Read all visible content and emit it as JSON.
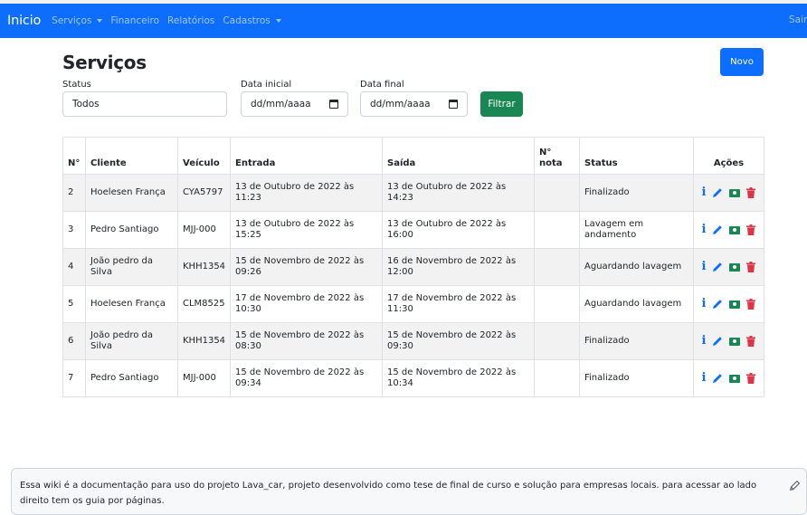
{
  "navbar": {
    "brand": "Inicio",
    "items": [
      {
        "label": "Serviços",
        "dropdown": true
      },
      {
        "label": "Financeiro",
        "dropdown": false
      },
      {
        "label": "Relatórios",
        "dropdown": false
      },
      {
        "label": "Cadastros",
        "dropdown": true
      }
    ],
    "logout": "Sair",
    "color": "#0d6efd"
  },
  "page": {
    "title": "Serviços",
    "new_button": "Novo"
  },
  "filters": {
    "status_label": "Status",
    "status_value": "Todos",
    "start_label": "Data inicial",
    "start_value": "dd/mm/aaaa",
    "end_label": "Data final",
    "end_value": "dd/mm/aaaa",
    "filter_button": "Filtrar"
  },
  "table": {
    "headers": {
      "num": "N°",
      "cliente": "Cliente",
      "veiculo": "Veículo",
      "entrada": "Entrada",
      "saida": "Saída",
      "nota": "N° nota",
      "status": "Status",
      "acoes": "Ações"
    },
    "rows": [
      {
        "num": "2",
        "cliente": "Hoelesen França",
        "veiculo": "CYA5797",
        "entrada": "13 de Outubro de 2022 às 11:23",
        "saida": "13 de Outubro de 2022 às 14:23",
        "nota": "",
        "status": "Finalizado"
      },
      {
        "num": "3",
        "cliente": "Pedro Santiago",
        "veiculo": "MJJ-000",
        "entrada": "13 de Outubro de 2022 às 15:25",
        "saida": "13 de Outubro de 2022 às 16:00",
        "nota": "",
        "status": "Lavagem em andamento"
      },
      {
        "num": "4",
        "cliente": "João pedro da Silva",
        "veiculo": "KHH1354",
        "entrada": "15 de Novembro de 2022 às 09:26",
        "saida": "16 de Novembro de 2022 às 12:00",
        "nota": "",
        "status": "Aguardando lavagem"
      },
      {
        "num": "5",
        "cliente": "Hoelesen França",
        "veiculo": "CLM8525",
        "entrada": "17 de Novembro de 2022 às 10:30",
        "saida": "17 de Novembro de 2022 às 11:30",
        "nota": "",
        "status": "Aguardando lavagem"
      },
      {
        "num": "6",
        "cliente": "João pedro da Silva",
        "veiculo": "KHH1354",
        "entrada": "15 de Novembro de 2022 às 08:30",
        "saida": "15 de Novembro de 2022 às 09:30",
        "nota": "",
        "status": "Finalizado"
      },
      {
        "num": "7",
        "cliente": "Pedro Santiago",
        "veiculo": "MJJ-000",
        "entrada": "15 de Novembro de 2022 às 09:34",
        "saida": "15 de Novembro de 2022 às 10:34",
        "nota": "",
        "status": "Finalizado"
      }
    ],
    "row_actions": [
      "info-icon",
      "edit-icon",
      "money-icon",
      "trash-icon"
    ]
  },
  "footer": {
    "text": "Essa wiki é a documentação para uso do projeto Lava_car, projeto desenvolvido como tese de final de curso e solução para empresas locais. para acessar ao lado direito tem os guia por páginas."
  },
  "colors": {
    "primary": "#0d6efd",
    "success": "#198754",
    "danger": "#dc3545",
    "stripe": "#f2f2f2"
  }
}
